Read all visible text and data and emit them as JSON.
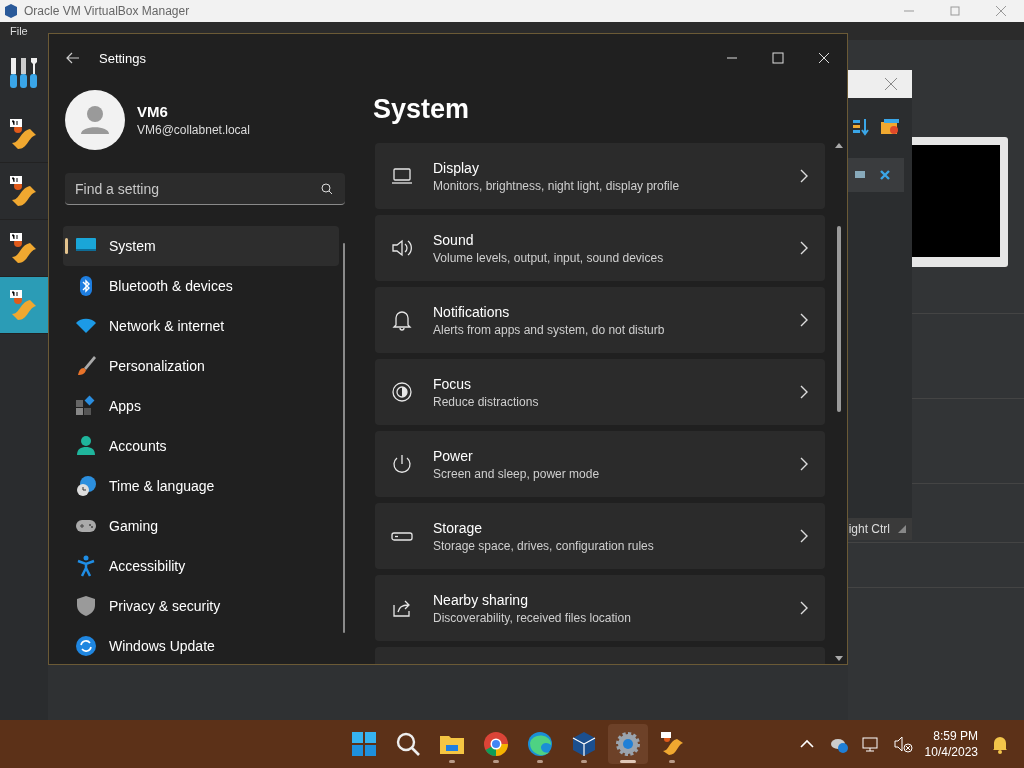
{
  "vbox": {
    "title": "Oracle VM VirtualBox Manager",
    "menu": [
      "File"
    ],
    "vms": [
      {
        "selected": false
      },
      {
        "selected": false
      },
      {
        "selected": false
      },
      {
        "selected": true
      }
    ],
    "vm_status": "ight Ctrl"
  },
  "settings": {
    "title": "Settings",
    "user": {
      "name": "VM6",
      "email": "VM6@collabnet.local"
    },
    "search": {
      "placeholder": "Find a setting"
    },
    "nav": [
      {
        "kind": "system",
        "label": "System",
        "selected": true
      },
      {
        "kind": "bluetooth",
        "label": "Bluetooth & devices",
        "selected": false
      },
      {
        "kind": "network",
        "label": "Network & internet",
        "selected": false
      },
      {
        "kind": "brush",
        "label": "Personalization",
        "selected": false
      },
      {
        "kind": "apps",
        "label": "Apps",
        "selected": false
      },
      {
        "kind": "accounts",
        "label": "Accounts",
        "selected": false
      },
      {
        "kind": "time",
        "label": "Time & language",
        "selected": false
      },
      {
        "kind": "gaming",
        "label": "Gaming",
        "selected": false
      },
      {
        "kind": "accessibility",
        "label": "Accessibility",
        "selected": false
      },
      {
        "kind": "privacy",
        "label": "Privacy & security",
        "selected": false
      },
      {
        "kind": "update",
        "label": "Windows Update",
        "selected": false
      }
    ],
    "heading": "System",
    "cards": [
      {
        "kind": "display",
        "title": "Display",
        "subtitle": "Monitors, brightness, night light, display profile"
      },
      {
        "kind": "sound",
        "title": "Sound",
        "subtitle": "Volume levels, output, input, sound devices"
      },
      {
        "kind": "notifications",
        "title": "Notifications",
        "subtitle": "Alerts from apps and system, do not disturb"
      },
      {
        "kind": "focus",
        "title": "Focus",
        "subtitle": "Reduce distractions"
      },
      {
        "kind": "power",
        "title": "Power",
        "subtitle": "Screen and sleep, power mode"
      },
      {
        "kind": "storage",
        "title": "Storage",
        "subtitle": "Storage space, drives, configuration rules"
      },
      {
        "kind": "sharing",
        "title": "Nearby sharing",
        "subtitle": "Discoverability, received files location"
      }
    ]
  },
  "taskbar": {
    "apps": [
      {
        "kind": "start",
        "running": false,
        "selected": false
      },
      {
        "kind": "search",
        "running": false,
        "selected": false
      },
      {
        "kind": "explorer",
        "running": true,
        "selected": false
      },
      {
        "kind": "chrome",
        "running": true,
        "selected": false
      },
      {
        "kind": "edge",
        "running": true,
        "selected": false
      },
      {
        "kind": "virtualbox",
        "running": true,
        "selected": false
      },
      {
        "kind": "settings",
        "running": true,
        "selected": true
      },
      {
        "kind": "vm",
        "running": true,
        "selected": false
      }
    ],
    "time": "8:59 PM",
    "date": "10/4/2023"
  }
}
